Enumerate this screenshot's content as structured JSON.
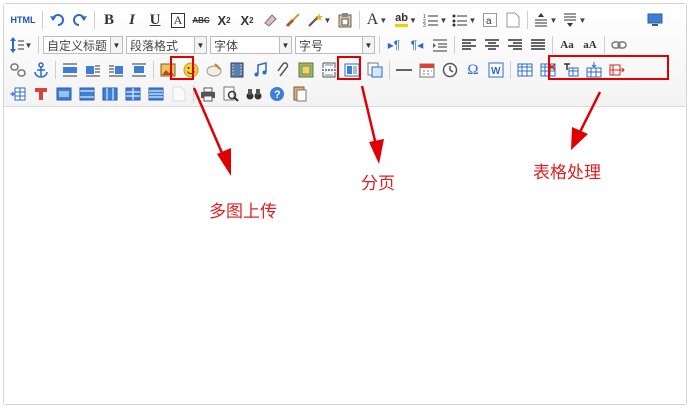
{
  "toolbar": {
    "html_label": "HTML",
    "custom_heading": "自定义标题",
    "paragraph_format": "段落格式",
    "font_family": "字体",
    "font_size": "字号"
  },
  "annotations": {
    "multi_image_upload": "多图上传",
    "page_break": "分页",
    "table_processing": "表格处理"
  },
  "colors": {
    "annotation_red": "#e02020",
    "highlight_red": "#e00000",
    "icon_blue": "#2a6cc6"
  }
}
